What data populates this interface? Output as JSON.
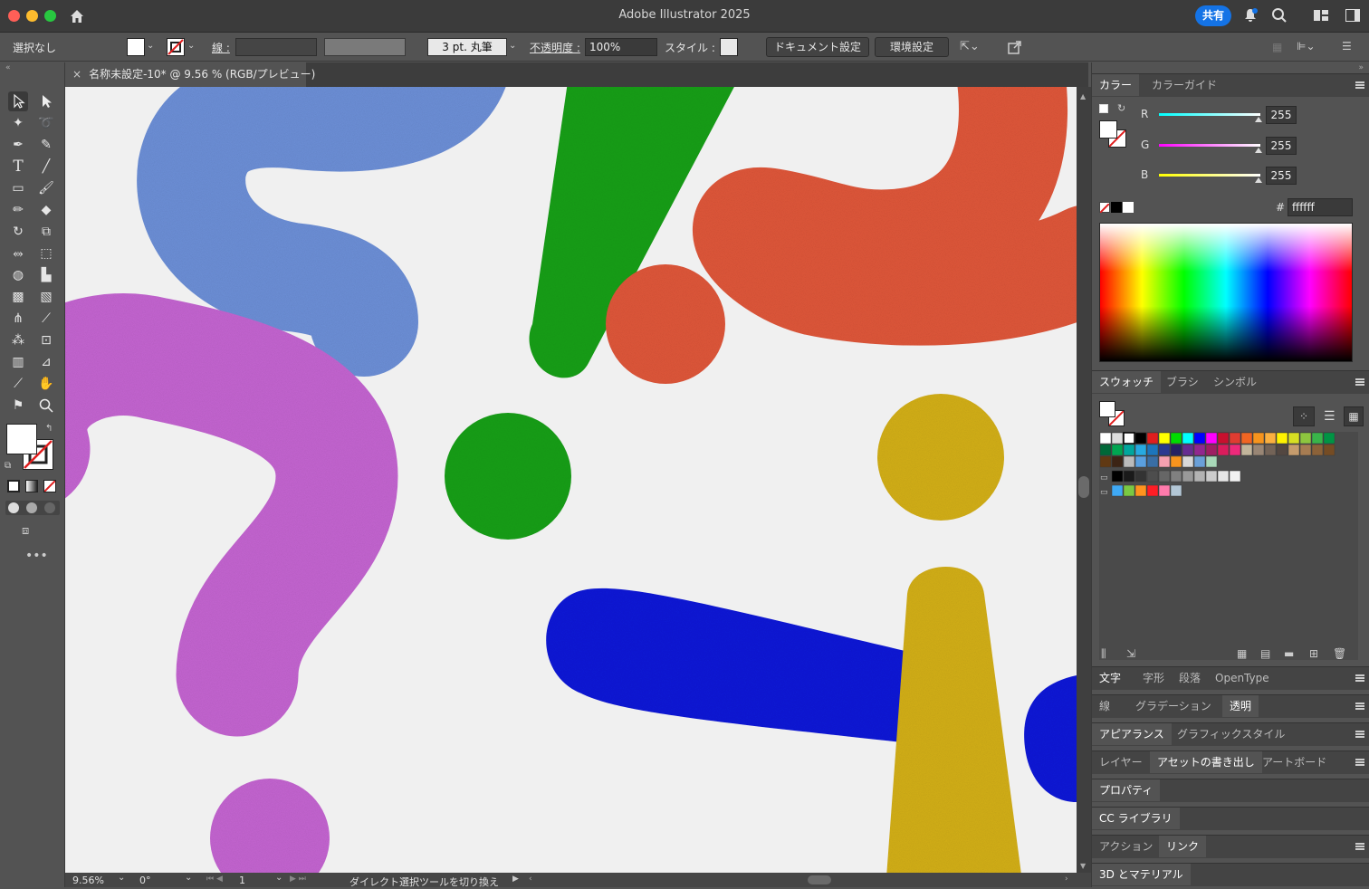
{
  "window": {
    "title": "Adobe Illustrator 2025",
    "share_label": "共有"
  },
  "control": {
    "selection": "選択なし",
    "stroke_label": "線 :",
    "brush_value": "3 pt. 丸筆",
    "opacity_label": "不透明度 :",
    "opacity_value": "100%",
    "style_label": "スタイル :",
    "doc_setup": "ドキュメント設定",
    "preferences": "環境設定"
  },
  "document": {
    "tab_title": "名称未設定-10* @ 9.56 % (RGB/プレビュー)"
  },
  "status": {
    "zoom": "9.56%",
    "rotation": "0°",
    "artboard": "1",
    "message": "ダイレクト選択ツールを切り換え"
  },
  "color_panel": {
    "tabs": [
      "カラー",
      "カラーガイド"
    ],
    "r_label": "R",
    "g_label": "G",
    "b_label": "B",
    "r": "255",
    "g": "255",
    "b": "255",
    "hash": "#",
    "hex": "ffffff"
  },
  "swatch_panel": {
    "tabs": [
      "スウォッチ",
      "ブラシ",
      "シンボル"
    ]
  },
  "panels": {
    "type_tabs": [
      "文字",
      "字形",
      "段落",
      "OpenType"
    ],
    "stroke_tabs": [
      "線",
      "グラデーション",
      "透明"
    ],
    "appearance_tabs": [
      "アピアランス",
      "グラフィックスタイル"
    ],
    "layer_tabs": [
      "レイヤー",
      "アセットの書き出し",
      "アートボード"
    ],
    "properties": "プロパティ",
    "cc_library": "CC ライブラリ",
    "action_tabs": [
      "アクション",
      "リンク"
    ],
    "materials": "3D とマテリアル"
  },
  "colors": {
    "accent": "#1473e6",
    "canvas": "#f0f0f0",
    "blue_shape": "#0a1ad8",
    "green_shape": "#12a012",
    "orange_shape": "#e0573a",
    "yellow_shape": "#d4b015",
    "magenta_shape": "#c060d0",
    "lightblue_shape": "#6a8ed8"
  }
}
